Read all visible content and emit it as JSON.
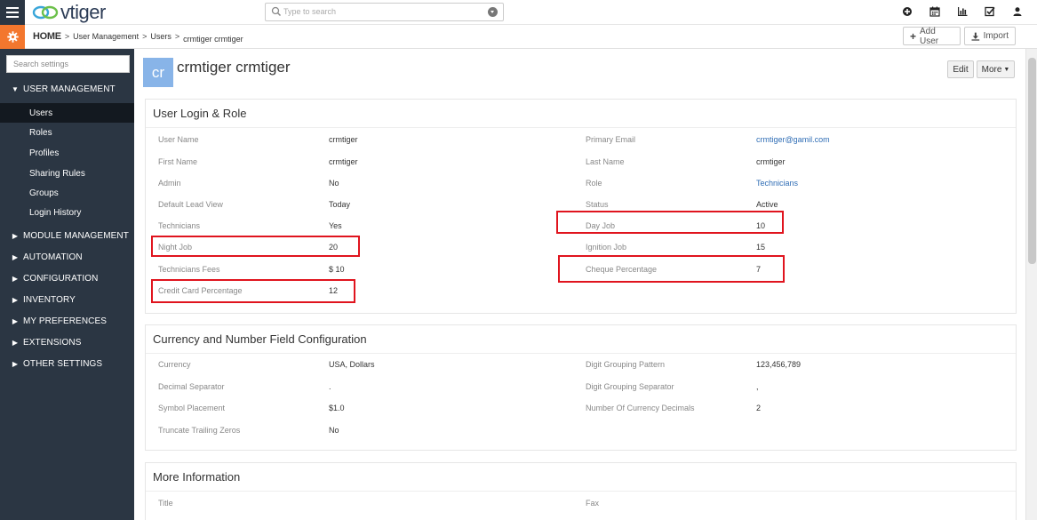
{
  "app": {
    "logo_text": "vtiger"
  },
  "search": {
    "placeholder": "Type to search"
  },
  "top_icons": [
    "plus-circle-icon",
    "calendar-icon",
    "reports-chart-icon",
    "tasks-check-icon",
    "user-icon"
  ],
  "breadcrumb": {
    "home": "HOME",
    "level1": "User Management",
    "level2": "Users",
    "current": "crmtiger crmtiger"
  },
  "header_buttons": {
    "add_user": "Add User",
    "import": "Import"
  },
  "sidebar": {
    "search_placeholder": "Search settings",
    "sections": [
      {
        "label": "USER MANAGEMENT",
        "expanded": true
      },
      {
        "label": "MODULE MANAGEMENT"
      },
      {
        "label": "AUTOMATION"
      },
      {
        "label": "CONFIGURATION"
      },
      {
        "label": "INVENTORY"
      },
      {
        "label": "MY PREFERENCES"
      },
      {
        "label": "EXTENSIONS"
      },
      {
        "label": "OTHER SETTINGS"
      }
    ],
    "items": [
      "Users",
      "Roles",
      "Profiles",
      "Sharing Rules",
      "Groups",
      "Login History"
    ],
    "active_item": "Users"
  },
  "record": {
    "avatar_initials": "cr",
    "title": "crmtiger crmtiger",
    "edit_label": "Edit",
    "more_label": "More"
  },
  "blocks": {
    "login_role": {
      "heading": "User Login & Role",
      "fields": [
        {
          "label": "User Name",
          "value": "crmtiger"
        },
        {
          "label": "Primary Email",
          "value": "crmtiger@gamil.com"
        },
        {
          "label": "First Name",
          "value": "crmtiger"
        },
        {
          "label": "Last Name",
          "value": "crmtiger"
        },
        {
          "label": "Admin",
          "value": "No"
        },
        {
          "label": "Role",
          "value": "Technicians"
        },
        {
          "label": "Default Lead View",
          "value": "Today"
        },
        {
          "label": "Status",
          "value": "Active"
        },
        {
          "label": "Technicians",
          "value": "Yes"
        },
        {
          "label": "Day Job",
          "value": "10"
        },
        {
          "label": "Night Job",
          "value": "20"
        },
        {
          "label": "Ignition Job",
          "value": "15"
        },
        {
          "label": "Technicians Fees",
          "value": "$ 10"
        },
        {
          "label": "Cheque Percentage",
          "value": "7"
        },
        {
          "label": "Credit Card Percentage",
          "value": "12"
        }
      ]
    },
    "currency": {
      "heading": "Currency and Number Field Configuration",
      "fields": [
        {
          "label": "Currency",
          "value": "USA, Dollars"
        },
        {
          "label": "Digit Grouping Pattern",
          "value": "123,456,789"
        },
        {
          "label": "Decimal Separator",
          "value": "."
        },
        {
          "label": "Digit Grouping Separator",
          "value": ","
        },
        {
          "label": "Symbol Placement",
          "value": "$1.0"
        },
        {
          "label": "Number Of Currency Decimals",
          "value": "2"
        },
        {
          "label": "Truncate Trailing Zeros",
          "value": "No"
        }
      ]
    },
    "more_info": {
      "heading": "More Information",
      "fields": [
        {
          "label": "Title",
          "value": ""
        },
        {
          "label": "Fax",
          "value": ""
        }
      ]
    }
  },
  "colors": {
    "sidebar_bg": "#2b3643",
    "sidebar_active_bg": "#131920",
    "settings_accent": "#f3772e",
    "avatar_bg": "#88b4e8",
    "link": "#2f6db5",
    "highlight_box": "#e0141e"
  }
}
